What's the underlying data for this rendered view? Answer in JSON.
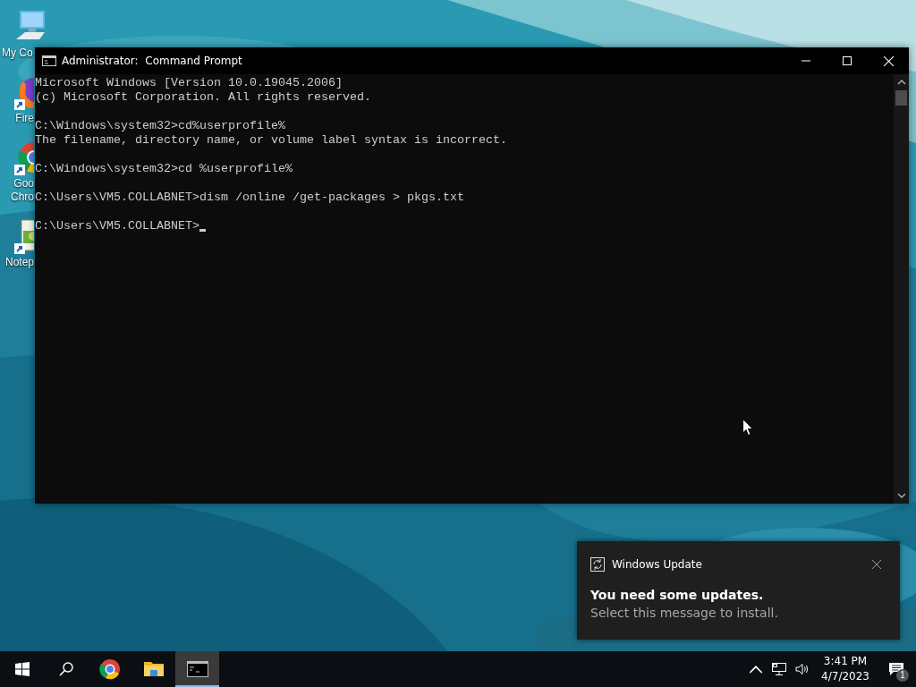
{
  "desktop_icons": [
    {
      "kind": "computer",
      "shortcut": false,
      "label_lines": [
        "My Co"
      ]
    },
    {
      "kind": "firefox",
      "shortcut": true,
      "label_lines": [
        "Fire"
      ]
    },
    {
      "kind": "chrome",
      "shortcut": true,
      "label_lines": [
        "Goo",
        "Chro"
      ]
    },
    {
      "kind": "notepad",
      "shortcut": true,
      "label_lines": [
        "Notep"
      ]
    }
  ],
  "window": {
    "title": "Administrator:  Command Prompt",
    "console_blocks": [
      [
        "Microsoft Windows [Version 10.0.19045.2006]",
        "(c) Microsoft Corporation. All rights reserved."
      ],
      [
        "C:\\Windows\\system32>cd%userprofile%",
        "The filename, directory name, or volume label syntax is incorrect."
      ],
      [
        "C:\\Windows\\system32>cd %userprofile%"
      ],
      [
        "C:\\Users\\VM5.COLLABNET>dism /online /get-packages > pkgs.txt"
      ],
      [
        "C:\\Users\\VM5.COLLABNET>"
      ]
    ]
  },
  "notification": {
    "app": "Windows Update",
    "title": "You need some updates.",
    "body": "Select this message to install."
  },
  "taskbar": {
    "items": [
      {
        "kind": "start",
        "selected": false
      },
      {
        "kind": "search",
        "selected": false
      },
      {
        "kind": "chrome",
        "selected": false
      },
      {
        "kind": "explorer",
        "selected": false
      },
      {
        "kind": "terminal",
        "selected": true
      }
    ],
    "time": "3:41 PM",
    "date": "4/7/2023",
    "notification_count": "1"
  }
}
